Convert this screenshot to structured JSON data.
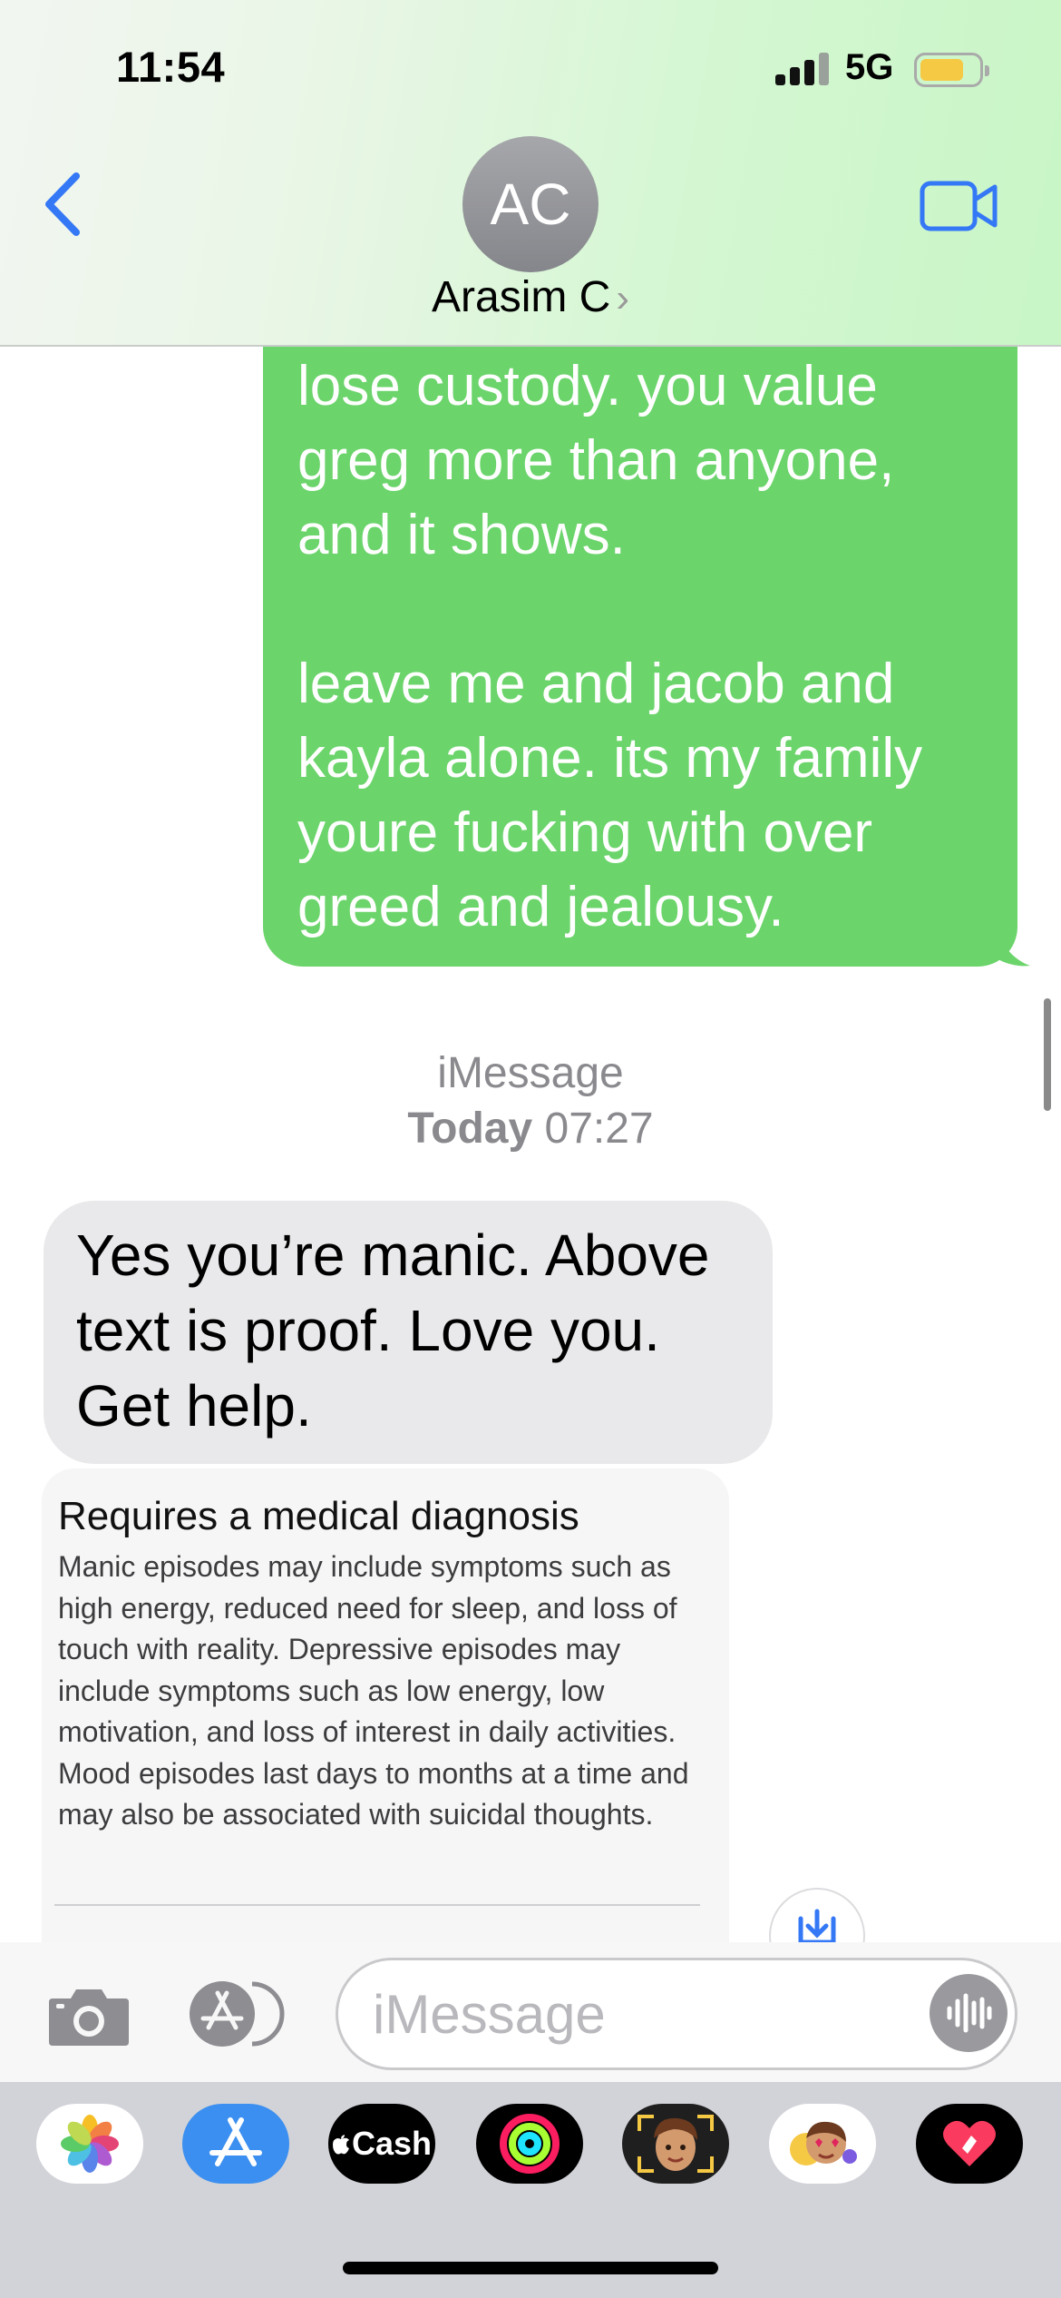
{
  "status_bar": {
    "time": "11:54",
    "network": "5G",
    "battery_level": 0.75,
    "battery_color": "#f6c945"
  },
  "header": {
    "back_icon": "chevron-left-icon",
    "avatar_initials": "AC",
    "contact_name": "Arasim C",
    "contact_chevron": "›",
    "video_icon": "video-camera-icon",
    "accent_color": "#3478f6"
  },
  "messages": {
    "sent_text": "lose custody. you value\ngreg more than anyone,\nand it shows.\n\nleave me and jacob and\nkayla alone. its my family\nyoure fucking with over\ngreed and jealousy.",
    "sent_bubble_color": "#6bd46b",
    "service_label": "iMessage",
    "timestamp_day": "Today",
    "timestamp_time": "07:27",
    "received_text": "Yes you’re manic. Above text is proof. Love you. Get help.",
    "received_bubble_color": "#e9e9eb"
  },
  "info_card": {
    "title": "Requires a medical diagnosis",
    "body": "Manic episodes may include symptoms such as high energy, reduced need for sleep, and loss of touch with reality. Depressive episodes may include symptoms such as low energy, low motivation, and loss of interest in daily activities. Mood episodes last days to months at a time and may also be associated with suicidal thoughts."
  },
  "compose": {
    "camera_icon": "camera-icon",
    "apps_icon": "app-store-icon",
    "placeholder": "iMessage",
    "audio_icon": "audio-waveform-icon"
  },
  "app_drawer": {
    "apps": [
      {
        "icon": "photos-icon"
      },
      {
        "icon": "app-store-icon"
      },
      {
        "icon": "apple-cash-icon",
        "label": "Cash"
      },
      {
        "icon": "fitness-rings-icon"
      },
      {
        "icon": "memoji-icon"
      },
      {
        "icon": "animoji-stickers-icon"
      },
      {
        "icon": "digital-touch-icon"
      }
    ]
  }
}
